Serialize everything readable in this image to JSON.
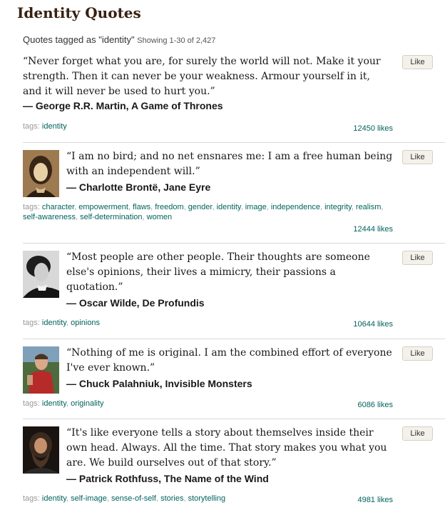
{
  "page": {
    "title": "Identity Quotes",
    "subheader_prefix": "Quotes tagged as \"identity\"",
    "subheader_count": "Showing 1-30 of 2,427"
  },
  "like_label": "Like",
  "tags_label": "tags:",
  "quotes": [
    {
      "text": "“Never forget what you are, for surely the world will not. Make it your strength. Then it can never be your weakness. Armour yourself in it, and it will never be used to hurt you.”",
      "author": "― George R.R. Martin, A Game of Thrones",
      "tags": [
        "identity"
      ],
      "likes": "12450 likes"
    },
    {
      "text": "“I am no bird; and no net ensnares me: I am a free human being with an independent will.”",
      "author": "― Charlotte Brontë, Jane Eyre",
      "tags": [
        "character",
        "empowerment",
        "flaws",
        "freedom",
        "gender",
        "identity",
        "image",
        "independence",
        "integrity",
        "realism",
        "self-awareness",
        "self-determination",
        "women"
      ],
      "likes": "12444 likes"
    },
    {
      "text": "“Most people are other people. Their thoughts are someone else's opinions, their lives a mimicry, their passions a quotation.”",
      "author": "― Oscar Wilde, De Profundis",
      "tags": [
        "identity",
        "opinions"
      ],
      "likes": "10644 likes"
    },
    {
      "text": "“Nothing of me is original. I am the combined effort of everyone I've ever known.”",
      "author": "― Chuck Palahniuk, Invisible Monsters",
      "tags": [
        "identity",
        "originality"
      ],
      "likes": "6086 likes"
    },
    {
      "text": "“It's like everyone tells a story about themselves inside their own head. Always. All the time. That story makes you what you are. We build ourselves out of that story.”",
      "author": "― Patrick Rothfuss, The Name of the Wind",
      "tags": [
        "identity",
        "self-image",
        "sense-of-self",
        "stories",
        "storytelling"
      ],
      "likes": "4981 likes"
    }
  ]
}
